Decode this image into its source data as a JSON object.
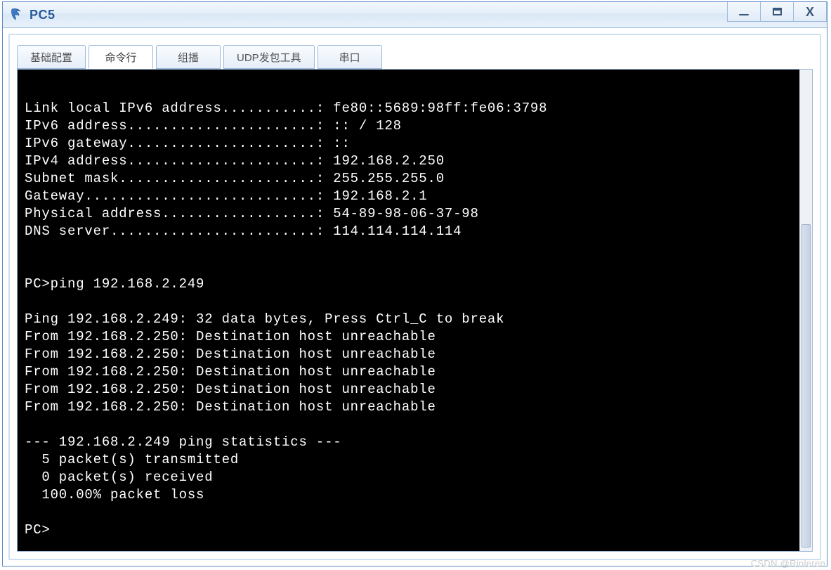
{
  "window": {
    "title": "PC5"
  },
  "tabs": [
    {
      "label": "基础配置",
      "active": false
    },
    {
      "label": "命令行",
      "active": true
    },
    {
      "label": "组播",
      "active": false
    },
    {
      "label": "UDP发包工具",
      "active": false
    },
    {
      "label": "串口",
      "active": false
    }
  ],
  "terminal": {
    "lines": [
      "",
      "Link local IPv6 address...........: fe80::5689:98ff:fe06:3798",
      "IPv6 address......................: :: / 128",
      "IPv6 gateway......................: ::",
      "IPv4 address......................: 192.168.2.250",
      "Subnet mask.......................: 255.255.255.0",
      "Gateway...........................: 192.168.2.1",
      "Physical address..................: 54-89-98-06-37-98",
      "DNS server........................: 114.114.114.114",
      "",
      "",
      "PC>ping 192.168.2.249",
      "",
      "Ping 192.168.2.249: 32 data bytes, Press Ctrl_C to break",
      "From 192.168.2.250: Destination host unreachable",
      "From 192.168.2.250: Destination host unreachable",
      "From 192.168.2.250: Destination host unreachable",
      "From 192.168.2.250: Destination host unreachable",
      "From 192.168.2.250: Destination host unreachable",
      "",
      "--- 192.168.2.249 ping statistics ---",
      "  5 packet(s) transmitted",
      "  0 packet(s) received",
      "  100.00% packet loss",
      "",
      "PC>"
    ]
  },
  "watermark": "CSDN @Rinleren"
}
